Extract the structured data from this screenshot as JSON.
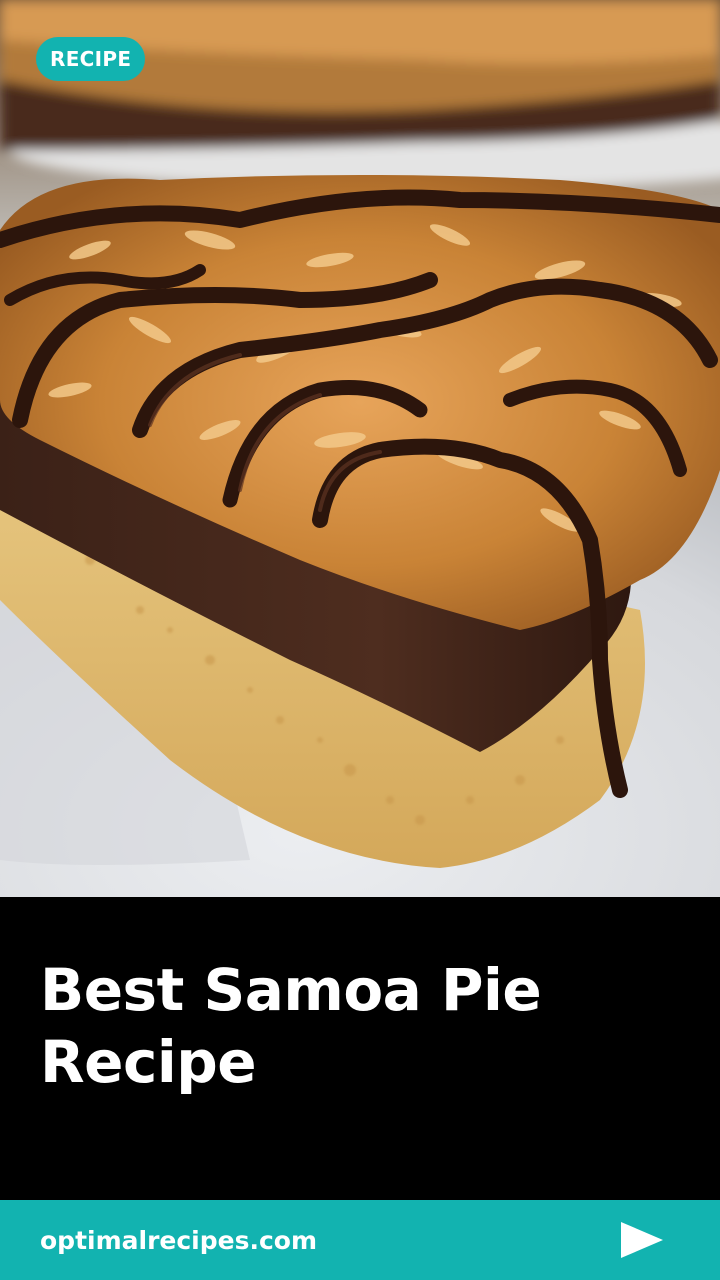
{
  "badge": {
    "label": "RECIPE"
  },
  "hero": {
    "subject": "samoa-pie-slice"
  },
  "title": {
    "text": "Best Samoa Pie Recipe"
  },
  "footer": {
    "site": "optimalrecipes.com",
    "next_icon": "play-arrow-icon"
  },
  "colors": {
    "accent": "#12b3b0",
    "panel": "#000000",
    "text": "#ffffff"
  }
}
